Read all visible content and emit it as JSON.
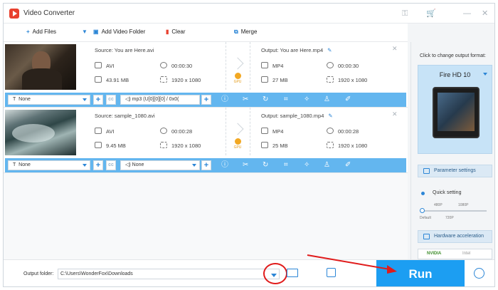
{
  "app": {
    "title": "Video Converter",
    "icons": [
      "key-icon",
      "cart-icon",
      "minimize-icon",
      "close-icon"
    ]
  },
  "toolbar": {
    "add_files": "Add Files",
    "add_video_folder": "Add Video Folder",
    "clear": "Clear",
    "merge": "Merge"
  },
  "items": [
    {
      "source": "Source: You are Here.avi",
      "src_format": "AVI",
      "src_duration": "00:00:30",
      "src_size": "43.91 MB",
      "src_res": "1920 x 1080",
      "output": "Output: You are Here.mp4",
      "out_format": "MP4",
      "out_duration": "00:00:30",
      "out_size": "27 MB",
      "out_res": "1920 x 1080",
      "gpu": "GPU",
      "subtitle": "None",
      "audio": "mp3 (U[0][0][0] / 0x0("
    },
    {
      "source": "Source: sample_1080.avi",
      "src_format": "AVI",
      "src_duration": "00:00:28",
      "src_size": "9.45 MB",
      "src_res": "1920 x 1080",
      "output": "Output: sample_1080.mp4",
      "out_format": "MP4",
      "out_duration": "00:00:28",
      "out_size": "25 MB",
      "out_res": "1920 x 1080",
      "gpu": "GPU",
      "subtitle": "None",
      "audio": "None"
    }
  ],
  "right": {
    "label": "Click to change output format:",
    "format": "Fire HD 10",
    "param": "Parameter settings",
    "quick": "Quick setting",
    "t480": "480P",
    "t1080": "1080P",
    "tdefault": "Default",
    "t720": "720P",
    "hwaccel": "Hardware acceleration",
    "nvidia": "NVIDIA",
    "intel": "Intel"
  },
  "bottom": {
    "output_label": "Output folder:",
    "path": "C:\\Users\\WonderFox\\Downloads",
    "run": "Run"
  },
  "colors": {
    "accent": "#1c9ef2",
    "bar": "#63b6ef",
    "highlight": "#e01b1b"
  }
}
